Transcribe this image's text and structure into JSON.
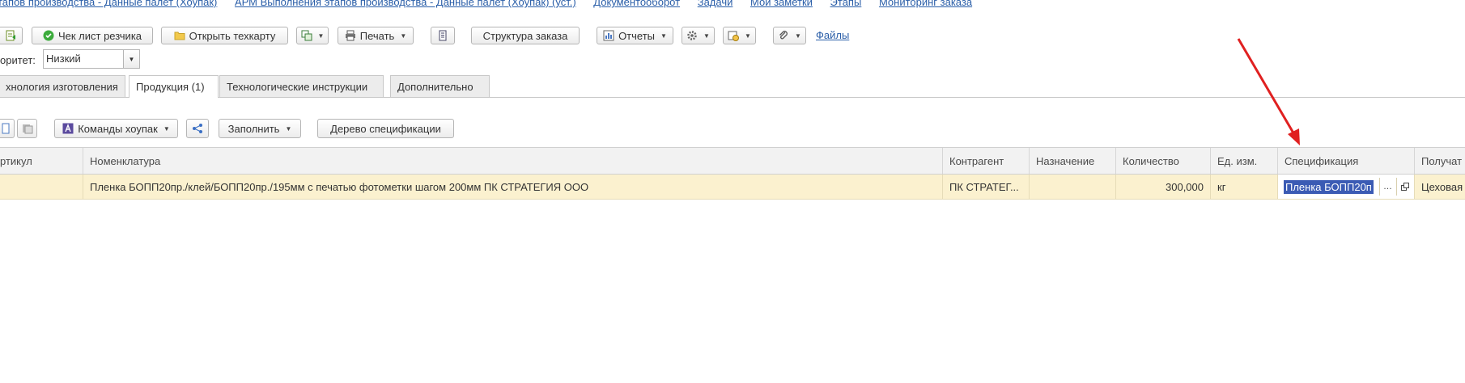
{
  "top_links": [
    "тапов производства - Данные палет (Хоупак)",
    "АРМ Выполнения этапов производства - Данные палет (Хоупак) (уст.)",
    "Документооборот",
    "Задачи",
    "Мои заметки",
    "Этапы",
    "Мониторинг заказа"
  ],
  "toolbar": {
    "checklist_label": "Чек лист резчика",
    "open_techcard_label": "Открыть техкарту",
    "print_label": "Печать",
    "order_structure_label": "Структура заказа",
    "reports_label": "Отчеты",
    "files_label": "Файлы"
  },
  "priority": {
    "label": "оритет:",
    "value": "Низкий"
  },
  "tabs": [
    {
      "label": "хнология изготовления"
    },
    {
      "label": "Продукция (1)"
    },
    {
      "label": "Технологические инструкции"
    },
    {
      "label": "Дополнительно"
    }
  ],
  "toolbar2": {
    "commands_label": "Команды хоупак",
    "fill_label": "Заполнить",
    "spec_tree_label": "Дерево спецификации"
  },
  "table": {
    "headers": {
      "article": "ртикул",
      "nomenclature": "Номенклатура",
      "contractor": "Контрагент",
      "purpose": "Назначение",
      "quantity": "Количество",
      "unit": "Ед. изм.",
      "specification": "Спецификация",
      "receiver": "Получат"
    },
    "rows": [
      {
        "article": "",
        "nomenclature": "Пленка БОПП20пр./клей/БОПП20пр./195мм с печатью фотометки шагом 200мм ПК СТРАТЕГИЯ ООО",
        "contractor": "ПК СТРАТЕГ...",
        "purpose": "",
        "quantity": "300,000",
        "unit": "кг",
        "specification": "Пленка БОПП20п",
        "receiver": "Цеховая"
      }
    ]
  },
  "colors": {
    "link": "#2a5ea8",
    "row_highlight": "#fbf1cf",
    "selection": "#3b5bb4",
    "arrow": "#e02020"
  }
}
